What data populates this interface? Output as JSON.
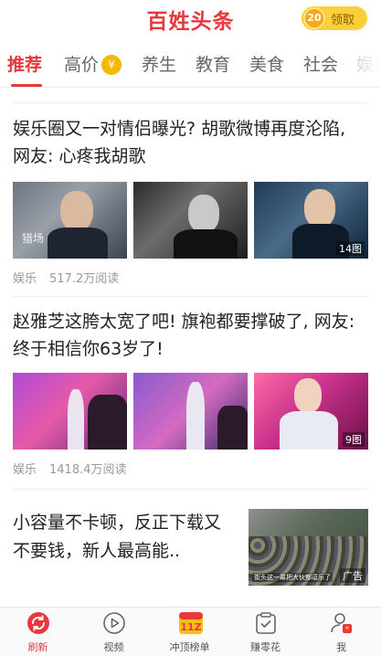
{
  "header": {
    "logo_text": "百姓头条",
    "coin_count": "20",
    "coin_label": "领取"
  },
  "tabs": [
    {
      "label": "推荐",
      "active": true
    },
    {
      "label": "高价",
      "badge": "¥"
    },
    {
      "label": "养生"
    },
    {
      "label": "教育"
    },
    {
      "label": "美食"
    },
    {
      "label": "社会"
    },
    {
      "label": "娱乐"
    }
  ],
  "articles": [
    {
      "title": "娱乐圈又一对情侣曝光? 胡歌微博再度沦陷, 网友: 心疼我胡歌",
      "thumb_caption": "猎场",
      "image_count": "14图",
      "category": "娱乐",
      "reads": "517.2万阅读"
    },
    {
      "title": "赵雅芝这胯太宽了吧! 旗袍都要撑破了, 网友: 终于相信你63岁了!",
      "image_count": "9图",
      "category": "娱乐",
      "reads": "1418.4万阅读"
    },
    {
      "title": "小容量不卡顿，反正下载又不要钱，新人最高能..",
      "ad_label": "广告",
      "ad_caption": "街头这一幕把大伙都逗乐了"
    }
  ],
  "bottom_nav": [
    {
      "label": "刷新",
      "icon": "refresh-icon",
      "active": true
    },
    {
      "label": "视频",
      "icon": "play-icon"
    },
    {
      "label": "冲顶榜单",
      "icon": "rank-icon"
    },
    {
      "label": "赚零花",
      "icon": "task-icon"
    },
    {
      "label": "我",
      "icon": "user-icon"
    }
  ],
  "colors": {
    "accent": "#e8383d",
    "coin": "#fbcf3a"
  }
}
